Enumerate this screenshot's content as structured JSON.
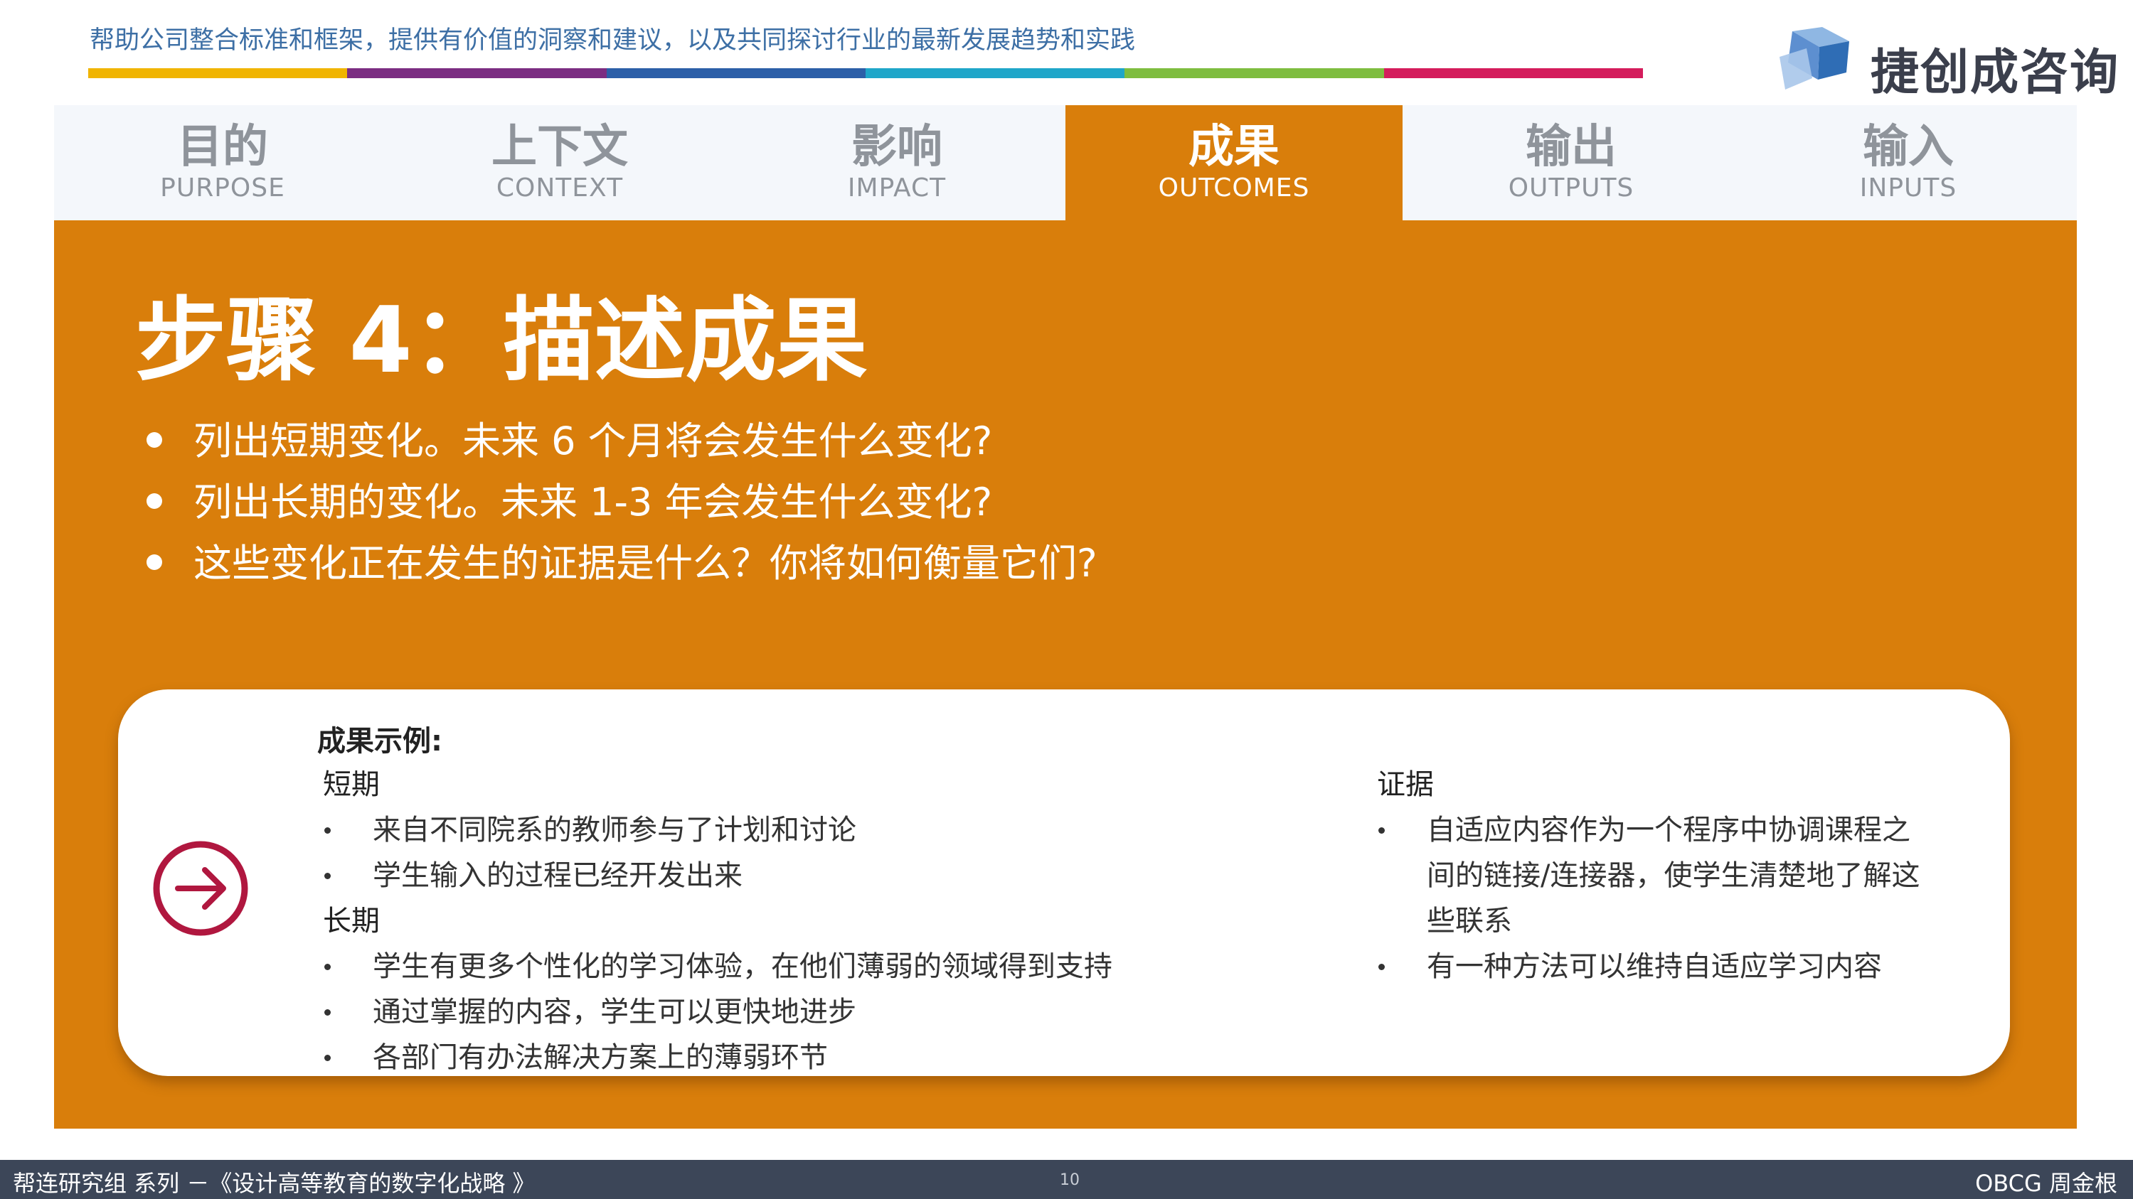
{
  "header": {
    "tagline": "帮助公司整合标准和框架，提供有价值的洞察和建议，以及共同探讨行业的最新发展趋势和实践",
    "stripe_colors": [
      "#f0b400",
      "#7b2d82",
      "#2c5fa8",
      "#1fa6c9",
      "#7ebd3f",
      "#d41c5c"
    ],
    "logo": {
      "text": "捷创成咨询",
      "icon": "cube-logo-icon"
    }
  },
  "tabs": [
    {
      "cn": "目的",
      "en": "PURPOSE",
      "active": false
    },
    {
      "cn": "上下文",
      "en": "CONTEXT",
      "active": false
    },
    {
      "cn": "影响",
      "en": "IMPACT",
      "active": false
    },
    {
      "cn": "成果",
      "en": "OUTCOMES",
      "active": true
    },
    {
      "cn": "输出",
      "en": "OUTPUTS",
      "active": false
    },
    {
      "cn": "输入",
      "en": "INPUTS",
      "active": false
    }
  ],
  "main": {
    "accent_color": "#d97e0b",
    "title": "步骤 4：描述成果",
    "bullets": [
      "列出短期变化。未来 6 个月将会发生什么变化?",
      "列出长期的变化。未来 1-3 年会发生什么变化?",
      "这些变化正在发生的证据是什么？你将如何衡量它们?"
    ]
  },
  "card": {
    "icon": "arrow-right-circle-icon",
    "icon_color": "#b0173f",
    "title": "成果示例:",
    "short_term": {
      "heading": "短期",
      "items": [
        "来自不同院系的教师参与了计划和讨论",
        "学生输入的过程已经开发出来"
      ]
    },
    "long_term": {
      "heading": "长期",
      "items": [
        "学生有更多个性化的学习体验，在他们薄弱的领域得到支持",
        "通过掌握的内容，学生可以更快地进步",
        "各部门有办法解决方案上的薄弱环节"
      ]
    },
    "evidence": {
      "heading": "证据",
      "items": [
        "自适应内容作为一个程序中协调课程之间的链接/连接器，使学生清楚地了解这些联系",
        "有一种方法可以维持自适应学习内容"
      ]
    }
  },
  "footer": {
    "left": "帮连研究组 系列 －《设计高等教育的数字化战略 》",
    "page_number": "10",
    "right": "OBCG 周金根"
  }
}
